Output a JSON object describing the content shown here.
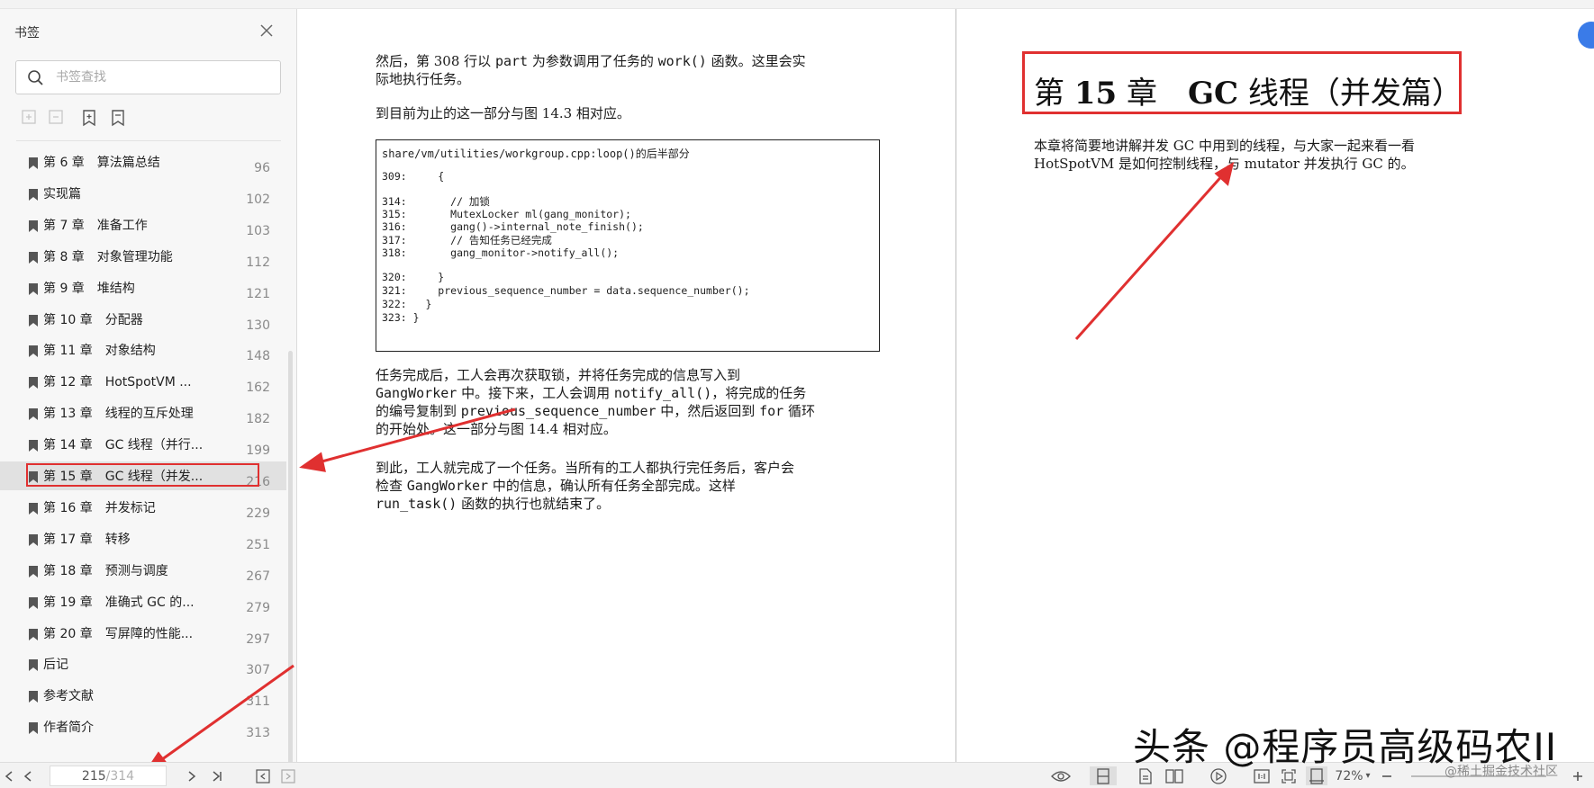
{
  "sidebar": {
    "title": "书签",
    "search_placeholder": "书签查找",
    "bookmarks": [
      {
        "label": "第 6 章　算法篇总结",
        "page": "96"
      },
      {
        "label": "实现篇",
        "page": "102"
      },
      {
        "label": "第 7 章　准备工作",
        "page": "103"
      },
      {
        "label": "第 8 章　对象管理功能",
        "page": "112"
      },
      {
        "label": "第 9 章　堆结构",
        "page": "121"
      },
      {
        "label": "第 10 章　分配器",
        "page": "130"
      },
      {
        "label": "第 11 章　对象结构",
        "page": "148"
      },
      {
        "label": "第 12 章　HotSpotVM ...",
        "page": "162"
      },
      {
        "label": "第 13 章　线程的互斥处理",
        "page": "182"
      },
      {
        "label": "第 14 章　GC 线程（并行...",
        "page": "199"
      },
      {
        "label": "第 15 章　GC 线程（并发...",
        "page": "216"
      },
      {
        "label": "第 16 章　并发标记",
        "page": "229"
      },
      {
        "label": "第 17 章　转移",
        "page": "251"
      },
      {
        "label": "第 18 章　预测与调度",
        "page": "267"
      },
      {
        "label": "第 19 章　准确式 GC 的...",
        "page": "279"
      },
      {
        "label": "第 20 章　写屏障的性能...",
        "page": "297"
      },
      {
        "label": "后记",
        "page": "307"
      },
      {
        "label": "参考文献",
        "page": "311"
      },
      {
        "label": "作者简介",
        "page": "313"
      }
    ]
  },
  "left_page": {
    "p1_a": "然后，第 308 行以 ",
    "p1_code1": "part",
    "p1_b": " 为参数调用了任务的 ",
    "p1_code2": "work()",
    "p1_c": " 函数。这里会实",
    "p1_line2": "际地执行任务。",
    "p2": "到目前为止的这一部分与图 14.3 相对应。",
    "code_caption_a": "share/vm/utilities/workgroup.cpp:loop()",
    "code_caption_b": "的后半部分",
    "code_lines": [
      "309:     {",
      "314:       // 加锁",
      "315:       MutexLocker ml(gang_monitor);",
      "316:       gang()->internal_note_finish();",
      "317:       // 告知任务已经完成",
      "318:       gang_monitor->notify_all();",
      "320:     }",
      "321:     previous_sequence_number = data.sequence_number();",
      "322:   }",
      "323: }"
    ],
    "p3_l1": "任务完成后，工人会再次获取锁，并将任务完成的信息写入到",
    "p3_l2a": "GangWorker",
    "p3_l2b": " 中。接下来，工人会调用 ",
    "p3_l2c": "notify_all()",
    "p3_l2d": "，将完成的任务",
    "p3_l3a": "的编号复制到 ",
    "p3_l3b": "previous_sequence_number",
    "p3_l3c": " 中，然后返回到 ",
    "p3_l3d": "for",
    "p3_l3e": " 循环",
    "p3_l4": "的开始处。这一部分与图 14.4 相对应。",
    "p4_l1": "到此，工人就完成了一个任务。当所有的工人都执行完任务后，客户会",
    "p4_l2a": "检查 ",
    "p4_l2b": "GangWorker",
    "p4_l2c": " 中的信息，确认所有任务全部完成。这样",
    "p4_l3a": "run_task()",
    "p4_l3b": " 函数的执行也就结束了。"
  },
  "right_page": {
    "chapter_prefix": "第 ",
    "chapter_num": "15",
    "chapter_mid": " 章　",
    "chapter_gc": "GC",
    "chapter_rest": " 线程（并发篇）",
    "intro_l1": "本章将简要地讲解并发 GC 中用到的线程，与大家一起来看一看",
    "intro_l2": "HotSpotVM 是如何控制线程，与 mutator 并发执行 GC 的。"
  },
  "bottom_bar": {
    "current_page": "215",
    "total_pages": "/314",
    "zoom": "72%"
  },
  "watermark": {
    "main": "头条 @程序员高级码农II",
    "sub": "@稀土掘金技术社区"
  },
  "colors": {
    "highlight": "#e03030",
    "sidebar_bg": "#f7f7f7"
  }
}
